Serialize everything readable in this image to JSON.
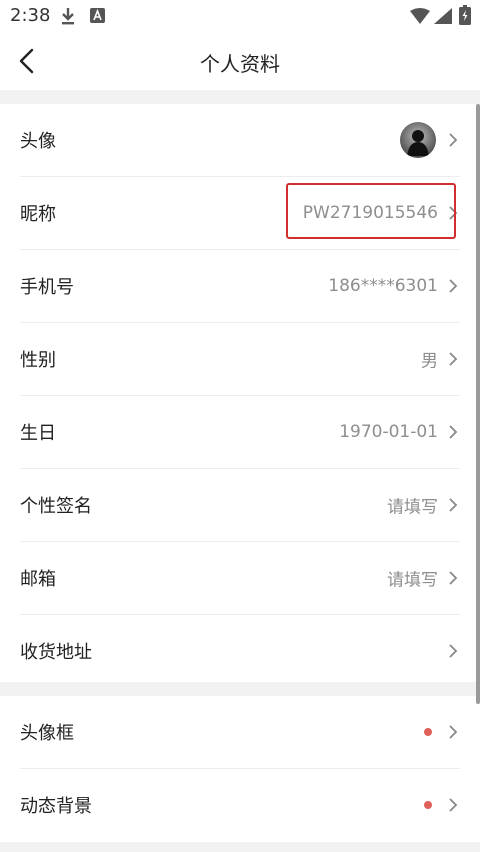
{
  "status_bar": {
    "time": "2:38",
    "icons": [
      "download-icon",
      "a-badge-icon",
      "wifi-icon",
      "signal-icon",
      "battery-charging-icon"
    ]
  },
  "header": {
    "title": "个人资料",
    "back_icon": "chevron-left-icon"
  },
  "profile_section": [
    {
      "label": "头像",
      "type": "avatar"
    },
    {
      "label": "昵称",
      "value": "PW2719015546"
    },
    {
      "label": "手机号",
      "value": "186****6301"
    },
    {
      "label": "性别",
      "value": "男"
    },
    {
      "label": "生日",
      "value": "1970-01-01"
    },
    {
      "label": "个性签名",
      "value": "请填写"
    },
    {
      "label": "邮箱",
      "value": "请填写"
    },
    {
      "label": "收货地址",
      "value": ""
    }
  ],
  "extras_section": [
    {
      "label": "头像框",
      "type": "dot"
    },
    {
      "label": "动态背景",
      "type": "dot"
    }
  ],
  "colors": {
    "dot": "#e0605a",
    "highlight": "#cf2f2f",
    "section_gap": "#f2f2f2",
    "value_text": "#8e8e8e"
  }
}
